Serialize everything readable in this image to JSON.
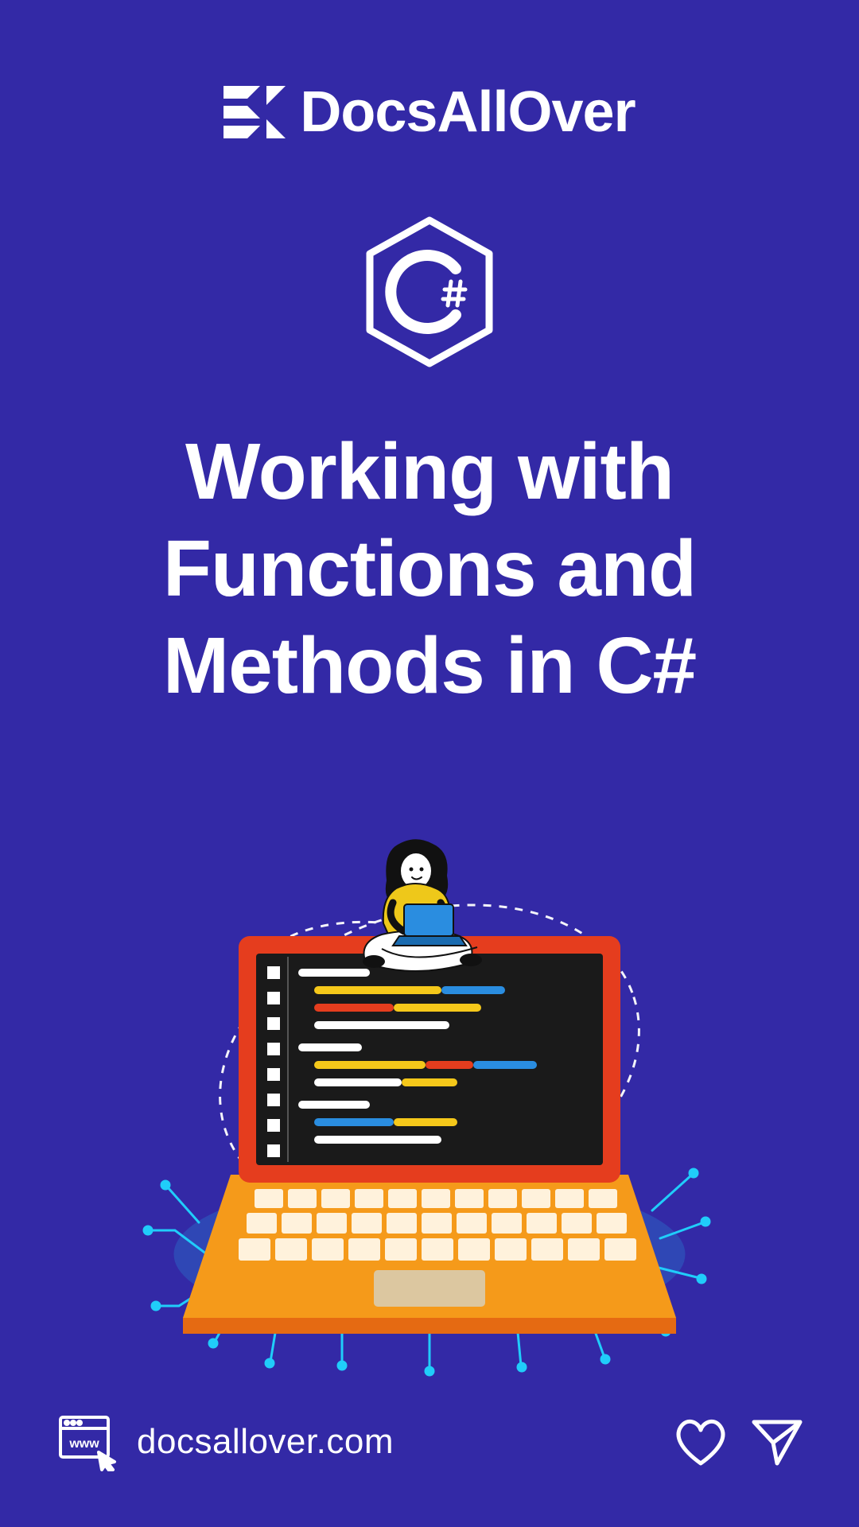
{
  "brand": {
    "name": "DocsAllOver"
  },
  "badge": {
    "label": "C#"
  },
  "title": "Working with Functions and Methods in C#",
  "footer": {
    "domain": "docsallover.com"
  },
  "colors": {
    "bg": "#3329a6",
    "fg": "#ffffff",
    "laptopBody": "#f59a1a",
    "laptopShade": "#e53d1e",
    "laptopKeys": "#fff2dc",
    "screen": "#1a1a1a",
    "circuit": "#1fd6ff",
    "personTop": "#eec81a",
    "personLaptop": "#2a8de0"
  }
}
